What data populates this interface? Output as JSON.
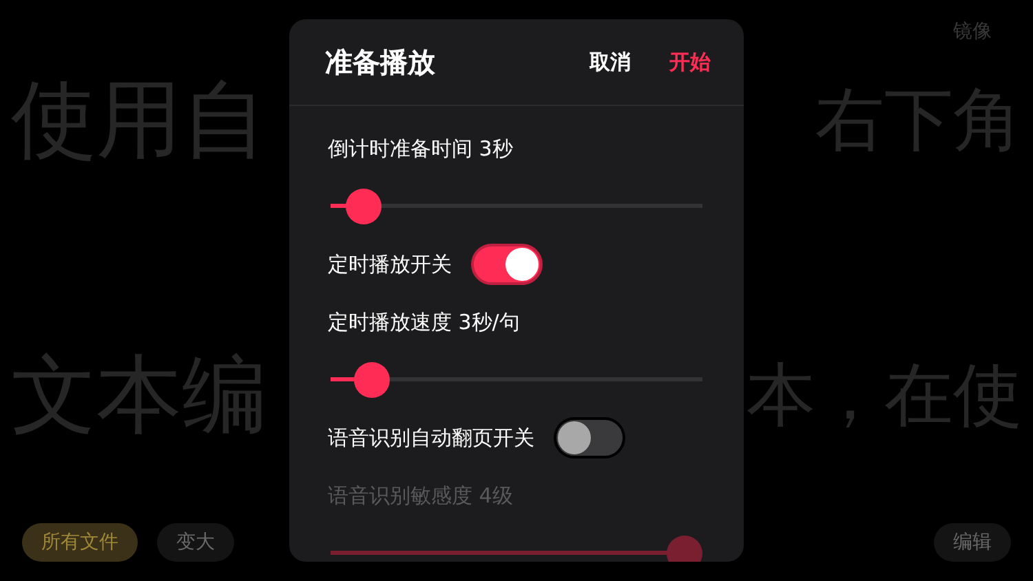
{
  "background": {
    "mirror_label": "镜像",
    "lines": [
      {
        "left": "使用自",
        "right": "右下角"
      },
      {
        "left": "文本编",
        "right": "本，在使"
      }
    ],
    "chips": [
      {
        "label": "所有文件",
        "selected": true
      },
      {
        "label": "变大",
        "selected": false
      }
    ],
    "edit_button": "编辑"
  },
  "dialog": {
    "title": "准备播放",
    "cancel": "取消",
    "confirm": "开始",
    "settings": [
      {
        "kind": "slider",
        "label": "倒计时准备时间 3秒",
        "level": 0.09,
        "disabled": false
      },
      {
        "kind": "toggle",
        "label": "定时播放开关",
        "on": true
      },
      {
        "kind": "slider",
        "label": "定时播放速度 3秒/句",
        "level": 0.11,
        "disabled": false
      },
      {
        "kind": "toggle",
        "label": "语音识别自动翻页开关",
        "on": false
      },
      {
        "kind": "slider",
        "label": "语音识别敏感度 4级",
        "level": 0.95,
        "disabled": true
      }
    ]
  }
}
